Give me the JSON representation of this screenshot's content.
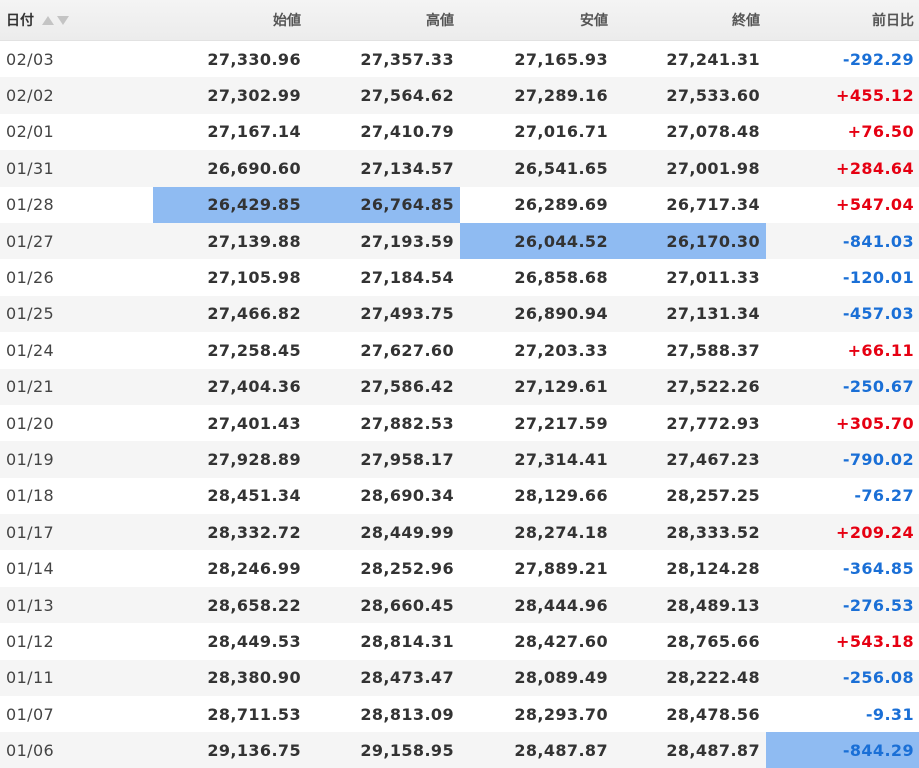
{
  "headers": {
    "date": "日付",
    "open": "始値",
    "high": "高値",
    "low": "安値",
    "close": "終値",
    "change": "前日比"
  },
  "colors": {
    "positive": "#e60012",
    "negative": "#1a6fd6",
    "highlight": "#8fbbf2",
    "row_alt": "#f5f5f5"
  },
  "rows": [
    {
      "date": "02/03",
      "open": "27,330.96",
      "high": "27,357.33",
      "low": "27,165.93",
      "close": "27,241.31",
      "change": "-292.29"
    },
    {
      "date": "02/02",
      "open": "27,302.99",
      "high": "27,564.62",
      "low": "27,289.16",
      "close": "27,533.60",
      "change": "+455.12"
    },
    {
      "date": "02/01",
      "open": "27,167.14",
      "high": "27,410.79",
      "low": "27,016.71",
      "close": "27,078.48",
      "change": "+76.50"
    },
    {
      "date": "01/31",
      "open": "26,690.60",
      "high": "27,134.57",
      "low": "26,541.65",
      "close": "27,001.98",
      "change": "+284.64"
    },
    {
      "date": "01/28",
      "open": "26,429.85",
      "high": "26,764.85",
      "low": "26,289.69",
      "close": "26,717.34",
      "change": "+547.04"
    },
    {
      "date": "01/27",
      "open": "27,139.88",
      "high": "27,193.59",
      "low": "26,044.52",
      "close": "26,170.30",
      "change": "-841.03"
    },
    {
      "date": "01/26",
      "open": "27,105.98",
      "high": "27,184.54",
      "low": "26,858.68",
      "close": "27,011.33",
      "change": "-120.01"
    },
    {
      "date": "01/25",
      "open": "27,466.82",
      "high": "27,493.75",
      "low": "26,890.94",
      "close": "27,131.34",
      "change": "-457.03"
    },
    {
      "date": "01/24",
      "open": "27,258.45",
      "high": "27,627.60",
      "low": "27,203.33",
      "close": "27,588.37",
      "change": "+66.11"
    },
    {
      "date": "01/21",
      "open": "27,404.36",
      "high": "27,586.42",
      "low": "27,129.61",
      "close": "27,522.26",
      "change": "-250.67"
    },
    {
      "date": "01/20",
      "open": "27,401.43",
      "high": "27,882.53",
      "low": "27,217.59",
      "close": "27,772.93",
      "change": "+305.70"
    },
    {
      "date": "01/19",
      "open": "27,928.89",
      "high": "27,958.17",
      "low": "27,314.41",
      "close": "27,467.23",
      "change": "-790.02"
    },
    {
      "date": "01/18",
      "open": "28,451.34",
      "high": "28,690.34",
      "low": "28,129.66",
      "close": "28,257.25",
      "change": "-76.27"
    },
    {
      "date": "01/17",
      "open": "28,332.72",
      "high": "28,449.99",
      "low": "28,274.18",
      "close": "28,333.52",
      "change": "+209.24"
    },
    {
      "date": "01/14",
      "open": "28,246.99",
      "high": "28,252.96",
      "low": "27,889.21",
      "close": "28,124.28",
      "change": "-364.85"
    },
    {
      "date": "01/13",
      "open": "28,658.22",
      "high": "28,660.45",
      "low": "28,444.96",
      "close": "28,489.13",
      "change": "-276.53"
    },
    {
      "date": "01/12",
      "open": "28,449.53",
      "high": "28,814.31",
      "low": "28,427.60",
      "close": "28,765.66",
      "change": "+543.18"
    },
    {
      "date": "01/11",
      "open": "28,380.90",
      "high": "28,473.47",
      "low": "28,089.49",
      "close": "28,222.48",
      "change": "-256.08"
    },
    {
      "date": "01/07",
      "open": "28,711.53",
      "high": "28,813.09",
      "low": "28,293.70",
      "close": "28,478.56",
      "change": "-9.31"
    },
    {
      "date": "01/06",
      "open": "29,136.75",
      "high": "29,158.95",
      "low": "28,487.87",
      "close": "28,487.87",
      "change": "-844.29"
    }
  ]
}
